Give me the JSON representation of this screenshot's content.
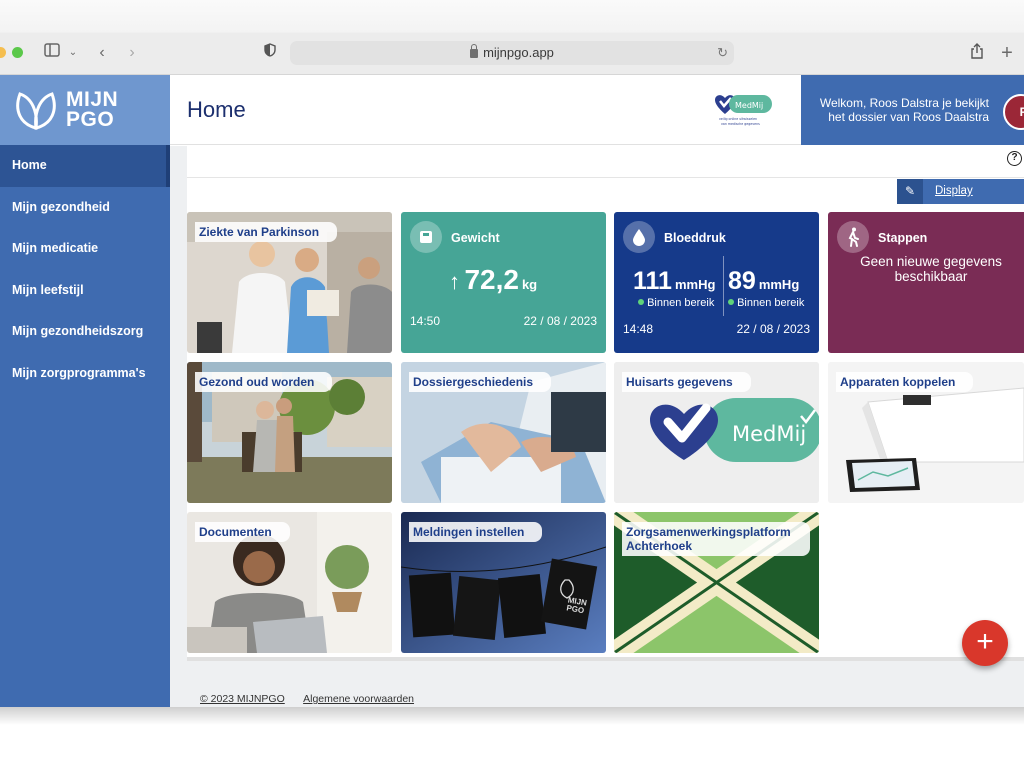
{
  "browser": {
    "url": "mijnpgo.app"
  },
  "brand": {
    "logo_line1": "MIJN",
    "logo_line2": "PGO"
  },
  "sidebar": {
    "items": [
      {
        "label": "Home",
        "active": true
      },
      {
        "label": "Mijn gezondheid"
      },
      {
        "label": "Mijn medicatie"
      },
      {
        "label": "Mijn leefstijl"
      },
      {
        "label": "Mijn gezondheidszorg"
      },
      {
        "label": "Mijn zorgprogramma's"
      }
    ]
  },
  "header": {
    "title": "Home",
    "welcome_line1": "Welkom, Roos Dalstra je bekijkt",
    "welcome_line2": "het dossier van Roos Daalstra",
    "avatar_initials": "RD",
    "medmij_tagline": "veilig online uitwisselen van medische gegevens"
  },
  "toolbar": {
    "help": "?",
    "edit_display_label": "Display bewerken"
  },
  "tiles": {
    "parkinson": "Ziekte van Parkinson",
    "weight": {
      "title": "Gewicht",
      "value": "72,2",
      "unit": "kg",
      "time": "14:50",
      "date": "22 / 08 / 2023"
    },
    "bloodpressure": {
      "title": "Bloeddruk",
      "systolic": "111",
      "diastolic": "89",
      "unit": "mmHg",
      "status1": "Binnen bereik",
      "status2": "Binnen bereik",
      "time": "14:48",
      "date": "22 / 08 / 2023"
    },
    "steps": {
      "title": "Stappen",
      "message": "Geen nieuwe gegevens beschikbaar"
    },
    "healthy_aging": "Gezond oud worden",
    "history": "Dossiergeschiedenis",
    "gp": "Huisarts gegevens",
    "medmij_word": "MedMij",
    "devices": "Apparaten koppelen",
    "documents": "Documenten",
    "notifications": "Meldingen instellen",
    "notif_logo_line1": "MIJN",
    "notif_logo_line2": "PGO",
    "platform": "Zorgsamenwerkingsplatform Achterhoek"
  },
  "footer": {
    "copyright": "© 2023 MIJNPGO",
    "terms": "Algemene voorwaarden"
  },
  "colors": {
    "sidebar": "#3f6bb0",
    "weight_tile": "#46a596",
    "bp_tile": "#163a8a",
    "steps_tile": "#7a2c55",
    "fab": "#d9372b"
  }
}
